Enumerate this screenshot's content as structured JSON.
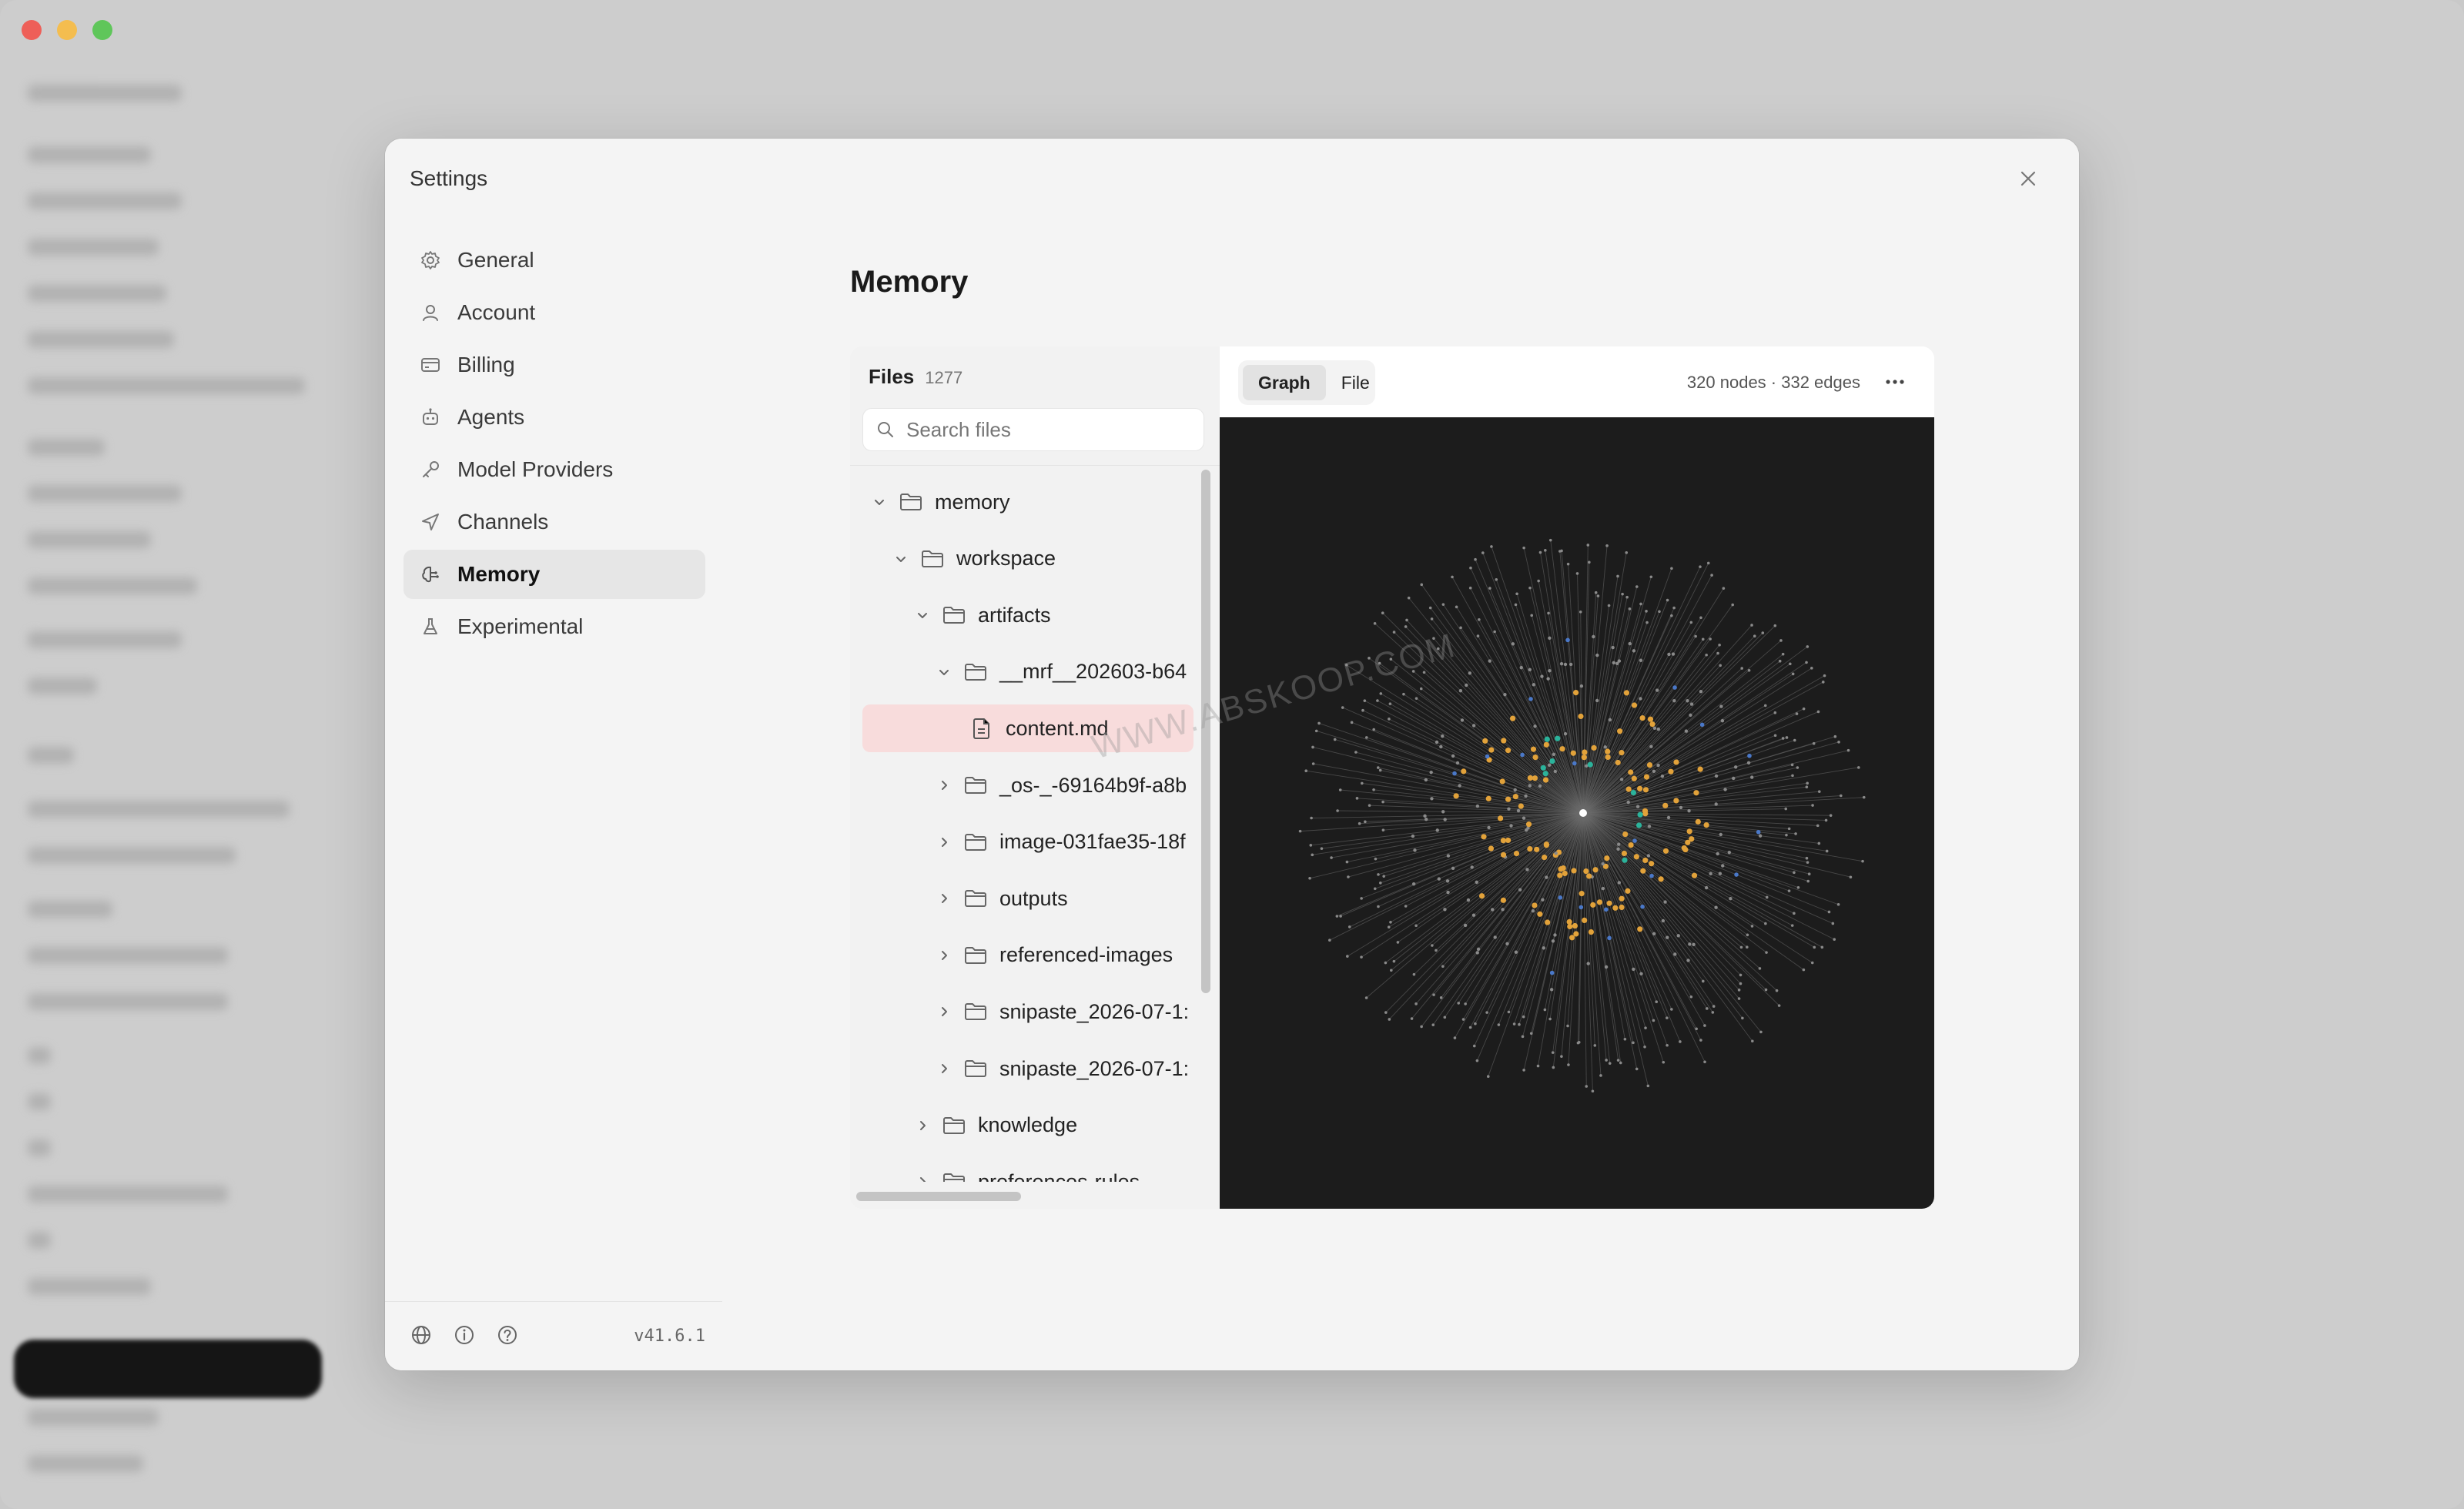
{
  "modal": {
    "title": "Settings"
  },
  "nav": {
    "items": [
      {
        "label": "General",
        "icon": "gear-icon"
      },
      {
        "label": "Account",
        "icon": "user-icon"
      },
      {
        "label": "Billing",
        "icon": "credit-card-icon"
      },
      {
        "label": "Agents",
        "icon": "bot-icon"
      },
      {
        "label": "Model Providers",
        "icon": "key-icon"
      },
      {
        "label": "Channels",
        "icon": "send-icon"
      },
      {
        "label": "Memory",
        "icon": "brain-icon",
        "active": true
      },
      {
        "label": "Experimental",
        "icon": "flask-icon"
      }
    ],
    "footer": {
      "icons": [
        "globe-icon",
        "info-icon",
        "help-icon"
      ],
      "version": "v41.6.1"
    }
  },
  "memory": {
    "title": "Memory",
    "files": {
      "title": "Files",
      "count": "1277",
      "search_placeholder": "Search files"
    },
    "tree": [
      {
        "label": "memory",
        "depth": 0,
        "type": "folder",
        "expanded": true
      },
      {
        "label": "workspace",
        "depth": 1,
        "type": "folder",
        "expanded": true
      },
      {
        "label": "artifacts",
        "depth": 2,
        "type": "folder",
        "expanded": true
      },
      {
        "label": "__mrf__202603-b64",
        "depth": 3,
        "type": "folder",
        "expanded": true
      },
      {
        "label": "content.md",
        "depth": 4,
        "type": "file",
        "selected": true
      },
      {
        "label": "_os-_-69164b9f-a8b",
        "depth": 3,
        "type": "folder",
        "expanded": false
      },
      {
        "label": "image-031fae35-18f",
        "depth": 3,
        "type": "folder",
        "expanded": false
      },
      {
        "label": "outputs",
        "depth": 3,
        "type": "folder",
        "expanded": false
      },
      {
        "label": "referenced-images",
        "depth": 3,
        "type": "folder",
        "expanded": false
      },
      {
        "label": "snipaste_2026-07-1:",
        "depth": 3,
        "type": "folder",
        "expanded": false
      },
      {
        "label": "snipaste_2026-07-1:",
        "depth": 3,
        "type": "folder",
        "expanded": false
      },
      {
        "label": "knowledge",
        "depth": 2,
        "type": "folder",
        "expanded": false
      },
      {
        "label": "preferences-rules",
        "depth": 2,
        "type": "folder",
        "expanded": false
      }
    ],
    "graph": {
      "tabs": [
        {
          "label": "Graph",
          "active": true
        },
        {
          "label": "File",
          "active": false
        }
      ],
      "stats": "320 nodes · 332 edges",
      "colors": {
        "background": "#1c1c1c",
        "edge": "#6b6b6b",
        "node_gray": "#8a8a8a",
        "node_orange": "#e2a23a",
        "node_teal": "#2bb39b",
        "node_blue": "#4a78c8",
        "center": "#ffffff"
      }
    }
  },
  "watermark": "WWW.ABSKOOP.COM"
}
